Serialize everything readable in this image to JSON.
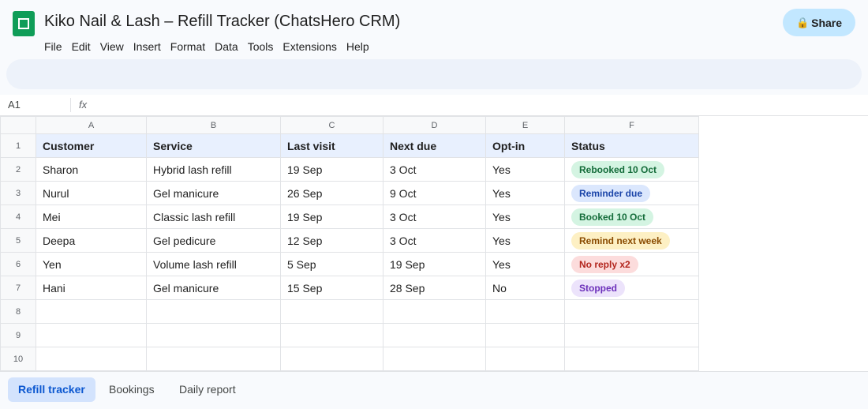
{
  "app": {
    "title": "Kiko Nail & Lash – Refill Tracker (ChatsHero CRM)",
    "menu": [
      "File",
      "Edit",
      "View",
      "Insert",
      "Format",
      "Data",
      "Tools",
      "Extensions",
      "Help"
    ],
    "share_icon": "lock-icon",
    "share_glyph": "🔒",
    "share_label": "Share"
  },
  "formula_bar": {
    "cell_ref": "A1",
    "fx_label": "fx"
  },
  "sheet": {
    "column_letters": [
      "A",
      "B",
      "C",
      "D",
      "E",
      "F"
    ],
    "row_numbers": [
      "1",
      "2",
      "3",
      "4",
      "5",
      "6",
      "7",
      "8",
      "9",
      "10"
    ],
    "headers": [
      "Customer",
      "Service",
      "Last visit",
      "Next due",
      "Opt-in",
      "Status"
    ],
    "rows": [
      {
        "customer": "Sharon",
        "service": "Hybrid lash refill",
        "last_visit": "19 Sep",
        "next_due": "3 Oct",
        "opt_in": "Yes",
        "status": "Rebooked 10 Oct",
        "status_kind": "green"
      },
      {
        "customer": "Nurul",
        "service": "Gel manicure",
        "last_visit": "26 Sep",
        "next_due": "9 Oct",
        "opt_in": "Yes",
        "status": "Reminder due",
        "status_kind": "blue"
      },
      {
        "customer": "Mei",
        "service": "Classic lash refill",
        "last_visit": "19 Sep",
        "next_due": "3 Oct",
        "opt_in": "Yes",
        "status": "Booked 10 Oct",
        "status_kind": "green"
      },
      {
        "customer": "Deepa",
        "service": "Gel pedicure",
        "last_visit": "12 Sep",
        "next_due": "3 Oct",
        "opt_in": "Yes",
        "status": "Remind next week",
        "status_kind": "amber"
      },
      {
        "customer": "Yen",
        "service": "Volume lash refill",
        "last_visit": "5 Sep",
        "next_due": "19 Sep",
        "opt_in": "Yes",
        "status": "No reply x2",
        "status_kind": "red"
      },
      {
        "customer": "Hani",
        "service": "Gel manicure",
        "last_visit": "15 Sep",
        "next_due": "28 Sep",
        "opt_in": "No",
        "status": "Stopped",
        "status_kind": "purple"
      }
    ],
    "status_colors": {
      "green": {
        "bg": "#d4f4e2",
        "fg": "#146c3a"
      },
      "blue": {
        "bg": "#dbe7fd",
        "fg": "#1a44a8"
      },
      "amber": {
        "bg": "#fdf0c4",
        "fg": "#8a4b00"
      },
      "red": {
        "bg": "#fcdcdc",
        "fg": "#b3261e"
      },
      "purple": {
        "bg": "#ece3fb",
        "fg": "#6b2fba"
      }
    }
  },
  "tabs": [
    {
      "label": "Refill tracker",
      "active": true
    },
    {
      "label": "Bookings",
      "active": false
    },
    {
      "label": "Daily report",
      "active": false
    }
  ]
}
